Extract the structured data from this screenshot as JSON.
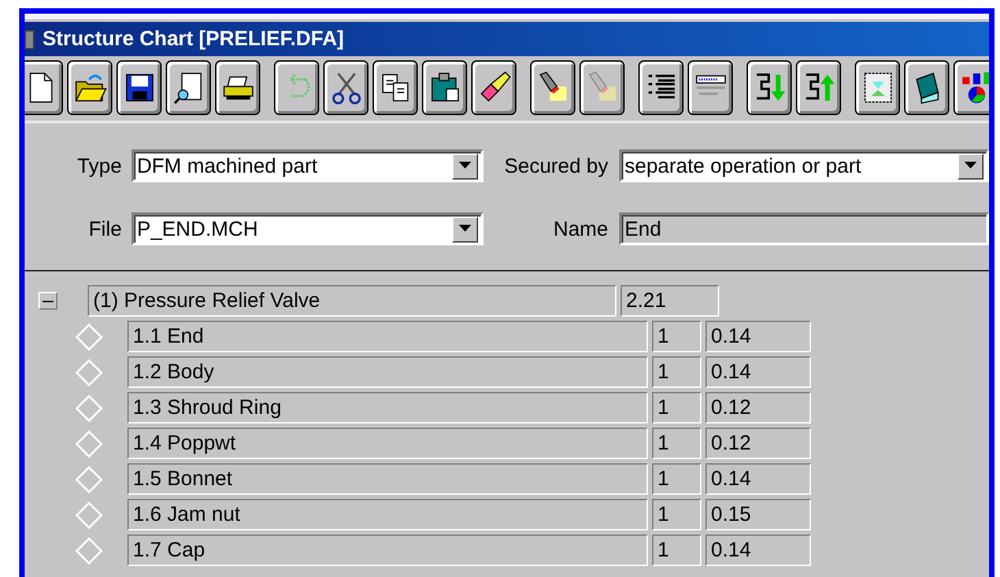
{
  "window": {
    "title": "Structure Chart [PRELIEF.DFA]"
  },
  "form": {
    "type": {
      "label": "Type",
      "value": "DFM machined part"
    },
    "secured_by": {
      "label": "Secured by",
      "value": "separate operation or part"
    },
    "file": {
      "label": "File",
      "value": "P_END.MCH"
    },
    "name": {
      "label": "Name",
      "value": "End",
      "disabled": true
    }
  },
  "tree": [
    {
      "label": "(1) Pressure Relief Valve",
      "value": "2.21",
      "expanded": true,
      "children": [
        {
          "label": "1.1 End",
          "qty": "1",
          "value": "0.14"
        },
        {
          "label": "1.2 Body",
          "qty": "1",
          "value": "0.14"
        },
        {
          "label": "1.3 Shroud Ring",
          "qty": "1",
          "value": "0.12"
        },
        {
          "label": "1.4 Poppwt",
          "qty": "1",
          "value": "0.12"
        },
        {
          "label": "1.5 Bonnet",
          "qty": "1",
          "value": "0.14"
        },
        {
          "label": "1.6 Jam nut",
          "qty": "1",
          "value": "0.15"
        },
        {
          "label": "1.7 Cap",
          "qty": "1",
          "value": "0.14"
        }
      ]
    }
  ]
}
